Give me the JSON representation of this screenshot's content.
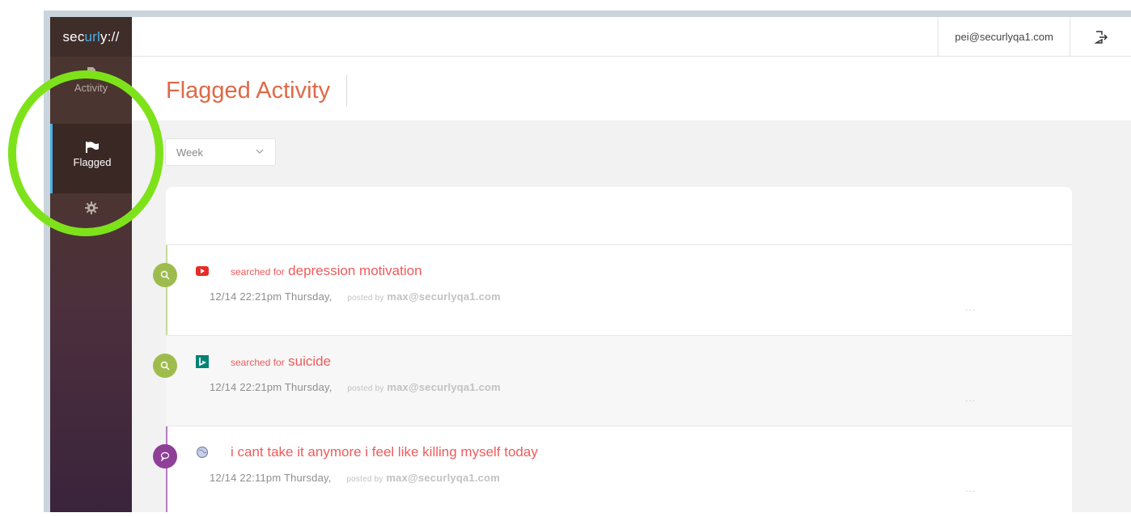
{
  "app": {
    "logo_prefix": "sec",
    "logo_accent": "url",
    "logo_suffix": "y://"
  },
  "sidebar": {
    "items": [
      {
        "label": "Activity",
        "icon": "document-icon"
      },
      {
        "label": "Flagged",
        "icon": "flag-icon",
        "active": true
      },
      {
        "label": "",
        "icon": "gear-icon"
      }
    ]
  },
  "topbar": {
    "user_email": "pei@securlyqa1.com",
    "logout_icon": "logout-icon"
  },
  "page": {
    "title": "Flagged Activity"
  },
  "filter": {
    "selected": "Week"
  },
  "feed": [
    {
      "badge_icon": "search-icon",
      "source_icon": "youtube-icon",
      "prefix": "searched for",
      "query": "depression motivation",
      "timestamp": "12/14 22:21pm Thursday,",
      "posted_by_label": "posted by",
      "poster": "max@securlyqa1.com",
      "more": "..."
    },
    {
      "badge_icon": "search-icon",
      "source_icon": "bing-icon",
      "prefix": "searched for",
      "query": "suicide",
      "timestamp": "12/14 22:21pm Thursday,",
      "posted_by_label": "posted by",
      "poster": "max@securlyqa1.com",
      "more": "..."
    },
    {
      "badge_icon": "chat-bubble-icon",
      "source_icon": "globe-icon",
      "prefix": "",
      "query": "i cant take it anymore i feel like killing myself today",
      "timestamp": "12/14 22:11pm Thursday,",
      "posted_by_label": "posted by",
      "poster": "max@securlyqa1.com",
      "more": "..."
    }
  ],
  "colors": {
    "accent_blue": "#4ab0e4",
    "title_orange": "#de6a47",
    "alert_red": "#ef5b5b",
    "badge_green": "#9ebc4e",
    "badge_purple": "#8e3f98",
    "highlight_green": "#7ee21a"
  }
}
